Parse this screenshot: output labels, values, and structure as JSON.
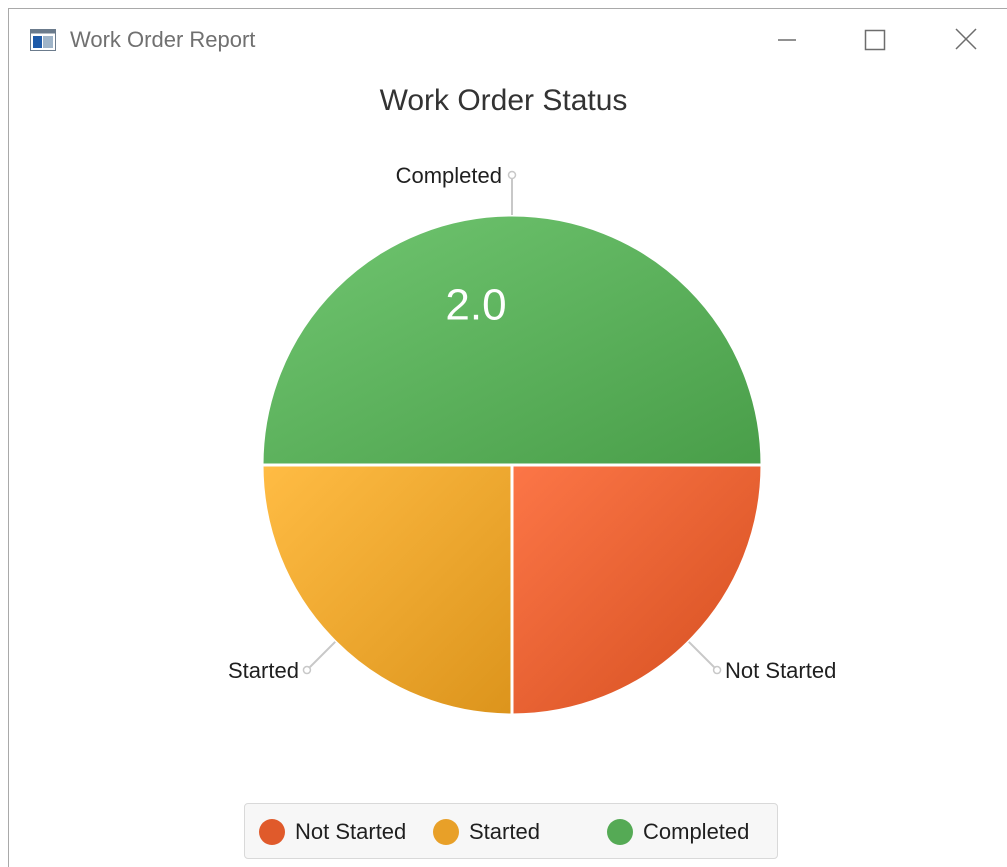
{
  "window": {
    "title": "Work Order Report",
    "minimize_label": "—",
    "maximize_label": "☐",
    "close_label": "✕"
  },
  "chart_data": {
    "type": "pie",
    "title": "Work Order Status",
    "categories": [
      "Not Started",
      "Started",
      "Completed"
    ],
    "values": [
      1.0,
      1.0,
      2.0
    ],
    "colors": [
      "#e05a2b",
      "#e8a028",
      "#55aa55"
    ],
    "data_labels": [
      "",
      "",
      "2.0"
    ],
    "legend_position": "bottom"
  },
  "legend": {
    "items": [
      "Not Started",
      "Started",
      "Completed"
    ]
  }
}
